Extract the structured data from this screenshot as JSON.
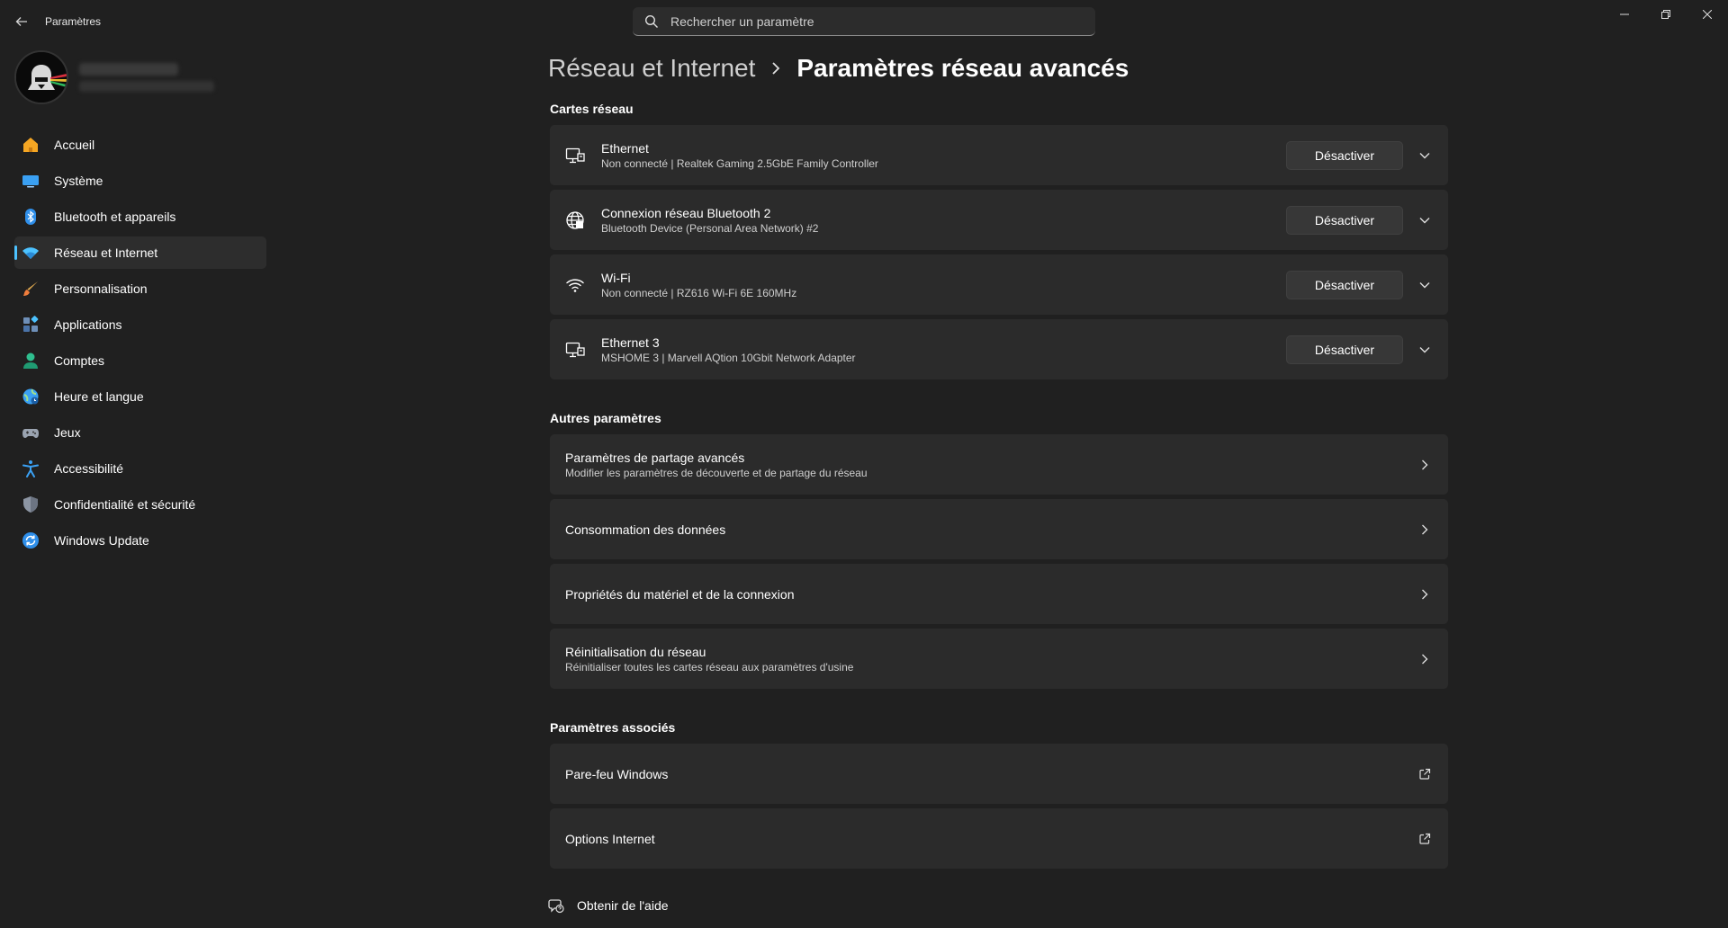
{
  "app": {
    "title": "Paramètres"
  },
  "search": {
    "placeholder": "Rechercher un paramètre"
  },
  "sidebar": {
    "items": [
      {
        "label": "Accueil",
        "icon": "home-icon"
      },
      {
        "label": "Système",
        "icon": "system-icon"
      },
      {
        "label": "Bluetooth et appareils",
        "icon": "bluetooth-icon"
      },
      {
        "label": "Réseau et Internet",
        "icon": "wifi-icon",
        "active": true
      },
      {
        "label": "Personnalisation",
        "icon": "brush-icon"
      },
      {
        "label": "Applications",
        "icon": "apps-icon"
      },
      {
        "label": "Comptes",
        "icon": "account-icon"
      },
      {
        "label": "Heure et langue",
        "icon": "globe-clock-icon"
      },
      {
        "label": "Jeux",
        "icon": "gamepad-icon"
      },
      {
        "label": "Accessibilité",
        "icon": "accessibility-icon"
      },
      {
        "label": "Confidentialité et sécurité",
        "icon": "shield-icon"
      },
      {
        "label": "Windows Update",
        "icon": "update-icon"
      }
    ]
  },
  "breadcrumb": {
    "parent": "Réseau et Internet",
    "current": "Paramètres réseau avancés"
  },
  "sections": {
    "adapters_title": "Cartes réseau",
    "other_title": "Autres paramètres",
    "related_title": "Paramètres associés"
  },
  "adapters": [
    {
      "name": "Ethernet",
      "detail": "Non connecté | Realtek Gaming 2.5GbE Family Controller",
      "button": "Désactiver",
      "icon": "ethernet-icon"
    },
    {
      "name": "Connexion réseau Bluetooth 2",
      "detail": "Bluetooth Device (Personal Area Network) #2",
      "button": "Désactiver",
      "icon": "globe-network-icon"
    },
    {
      "name": "Wi-Fi",
      "detail": "Non connecté | RZ616 Wi-Fi 6E 160MHz",
      "button": "Désactiver",
      "icon": "wifi-icon"
    },
    {
      "name": "Ethernet 3",
      "detail": "MSHOME 3 | Marvell AQtion 10Gbit Network Adapter",
      "button": "Désactiver",
      "icon": "ethernet-icon"
    }
  ],
  "other": [
    {
      "title": "Paramètres de partage avancés",
      "subtitle": "Modifier les paramètres de découverte et de partage du réseau"
    },
    {
      "title": "Consommation des données",
      "subtitle": ""
    },
    {
      "title": "Propriétés du matériel et de la connexion",
      "subtitle": ""
    },
    {
      "title": "Réinitialisation du réseau",
      "subtitle": "Réinitialiser toutes les cartes réseau aux paramètres d'usine"
    }
  ],
  "related": [
    {
      "title": "Pare-feu Windows"
    },
    {
      "title": "Options Internet"
    }
  ],
  "help": {
    "label": "Obtenir de l'aide"
  },
  "colors": {
    "background": "#202020",
    "card": "#2b2b2b",
    "accent": "#4cc2ff"
  }
}
